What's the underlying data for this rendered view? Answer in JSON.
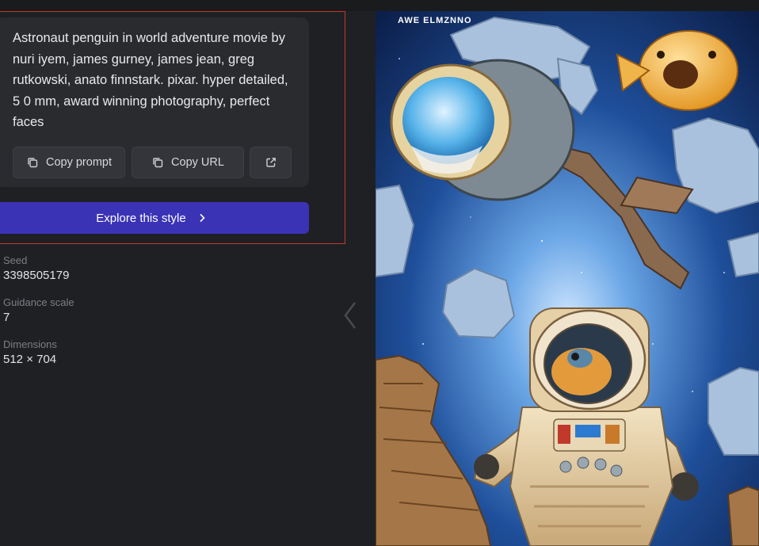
{
  "prompt": {
    "text": "Astronaut penguin in world adventure movie by nuri iyem, james gurney, james jean, greg rutkowski, anato finnstark. pixar. hyper detailed, 5 0 mm, award winning photography, perfect faces",
    "copy_prompt_label": "Copy prompt",
    "copy_url_label": "Copy URL",
    "open_external_icon": "external-link-icon",
    "copy_icon": "copy-icon"
  },
  "explore": {
    "label": "Explore this style",
    "icon": "chevron-right-icon"
  },
  "details": {
    "seed_label": "Seed",
    "seed_value": "3398505179",
    "guidance_label": "Guidance scale",
    "guidance_value": "7",
    "dimensions_label": "Dimensions",
    "dimensions_value": "512 × 704"
  },
  "navigation": {
    "prev_icon": "chevron-left-icon"
  },
  "image": {
    "watermark_text": "AWE ELMZNNO",
    "subject": "generated-image"
  },
  "colors": {
    "background": "#1f2023",
    "card": "#2a2b2f",
    "button": "#34353a",
    "accent": "#3b33b5",
    "highlight": "#c0392b",
    "label": "#7d7e84"
  }
}
